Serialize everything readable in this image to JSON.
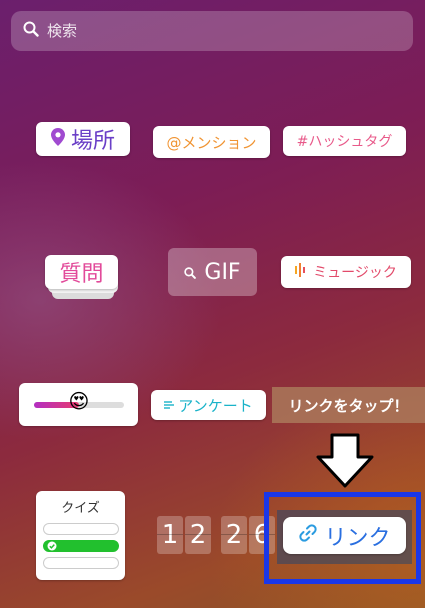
{
  "search": {
    "placeholder": "検索",
    "icon": "search-icon"
  },
  "stickers": {
    "location": {
      "label": "場所",
      "icon": "location-pin-icon"
    },
    "mention": {
      "label": "@メンション"
    },
    "hashtag": {
      "label": "#ハッシュタグ"
    },
    "question": {
      "label": "質問"
    },
    "gif": {
      "label": "GIF",
      "icon": "search-icon"
    },
    "music": {
      "label": "ミュージック",
      "icon": "music-bars-icon"
    },
    "slider": {
      "emoji": "😍",
      "level_percent": 50
    },
    "poll": {
      "label": "アンケート",
      "icon": "list-lines-icon"
    },
    "quiz": {
      "label": "クイズ"
    },
    "countdown": {
      "digits": [
        "1",
        "2",
        "2",
        "6"
      ]
    },
    "link": {
      "label": "リンク",
      "icon": "link-icon"
    }
  },
  "annotation": {
    "callout_text": "リンクをタップ！",
    "arrow_icon": "down-arrow-icon",
    "highlight_color": "#1a37e8"
  }
}
